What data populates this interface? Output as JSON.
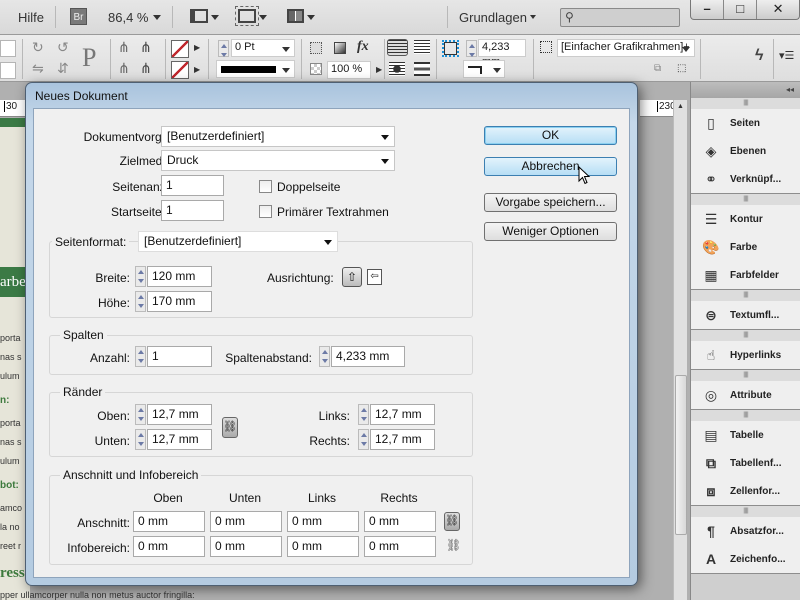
{
  "menubar": {
    "help": "Hilfe",
    "bridge": "Br",
    "zoom": "86,4 %",
    "workspace": "Grundlagen",
    "search_placeholder": "",
    "window_buttons": {
      "minimize": "–",
      "maximize": "□",
      "close": "✕"
    }
  },
  "control_bar": {
    "stroke_weight": "0 Pt",
    "opacity": "100 %",
    "offset": "4,233 mm",
    "object_style": "[Einfacher Grafikrahmen]+"
  },
  "canvas": {
    "ruler_left": "30",
    "ruler_right": "230",
    "page_text": [
      "arbe",
      "porta",
      "nas s",
      "ulum",
      "n:",
      "porta",
      "nas s",
      "ulum",
      "bot:",
      "amco",
      "la no",
      "reet r",
      "ress",
      "pper ullamcorper nulla non metus auctor fringilla:"
    ]
  },
  "dialog": {
    "title": "Neues Dokument",
    "preset_label": "Dokumentvorgabe:",
    "preset_value": "[Benutzerdefiniert]",
    "intent_label": "Zielmedium:",
    "intent_value": "Druck",
    "pages_label": "Seitenanzahl:",
    "pages_value": "1",
    "start_label": "Startseitennr.:",
    "start_value": "1",
    "facing_pages": {
      "label": "Doppelseite",
      "checked": false
    },
    "primary_frame": {
      "label": "Primärer Textrahmen",
      "checked": false
    },
    "page_size_label": "Seitenformat:",
    "page_size_value": "[Benutzerdefiniert]",
    "width_label": "Breite:",
    "width_value": "120 mm",
    "height_label": "Höhe:",
    "height_value": "170 mm",
    "orientation_label": "Ausrichtung:",
    "orientation": "portrait",
    "columns": {
      "title": "Spalten",
      "count_label": "Anzahl:",
      "count_value": "1",
      "gutter_label": "Spaltenabstand:",
      "gutter_value": "4,233 mm"
    },
    "margins": {
      "title": "Ränder",
      "top_label": "Oben:",
      "top_value": "12,7 mm",
      "bottom_label": "Unten:",
      "bottom_value": "12,7 mm",
      "left_label": "Links:",
      "left_value": "12,7 mm",
      "right_label": "Rechts:",
      "right_value": "12,7 mm"
    },
    "bleed": {
      "title": "Anschnitt und Infobereich",
      "headers": [
        "Oben",
        "Unten",
        "Links",
        "Rechts"
      ],
      "bleed_label": "Anschnitt:",
      "bleed_values": [
        "0 mm",
        "0 mm",
        "0 mm",
        "0 mm"
      ],
      "slug_label": "Infobereich:",
      "slug_values": [
        "0 mm",
        "0 mm",
        "0 mm",
        "0 mm"
      ]
    },
    "buttons": {
      "ok": "OK",
      "cancel": "Abbrechen",
      "save_preset": "Vorgabe speichern...",
      "fewer_options": "Weniger Optionen"
    }
  },
  "panels": {
    "groups": [
      [
        {
          "label": "Seiten",
          "icon": "pages-icon"
        },
        {
          "label": "Ebenen",
          "icon": "layers-icon"
        },
        {
          "label": "Verknüpf...",
          "icon": "links-icon"
        }
      ],
      [
        {
          "label": "Kontur",
          "icon": "stroke-icon"
        },
        {
          "label": "Farbe",
          "icon": "color-icon"
        },
        {
          "label": "Farbfelder",
          "icon": "swatches-icon"
        }
      ],
      [
        {
          "label": "Textumfl...",
          "icon": "text-wrap-icon"
        }
      ],
      [
        {
          "label": "Hyperlinks",
          "icon": "hyperlinks-icon"
        }
      ],
      [
        {
          "label": "Attribute",
          "icon": "attributes-icon"
        }
      ],
      [
        {
          "label": "Tabelle",
          "icon": "table-icon"
        },
        {
          "label": "Tabellenf...",
          "icon": "table-styles-icon"
        },
        {
          "label": "Zellenfor...",
          "icon": "cell-styles-icon"
        }
      ],
      [
        {
          "label": "Absatzfor...",
          "icon": "paragraph-styles-icon"
        },
        {
          "label": "Zeichenfo...",
          "icon": "character-styles-icon"
        }
      ]
    ]
  }
}
